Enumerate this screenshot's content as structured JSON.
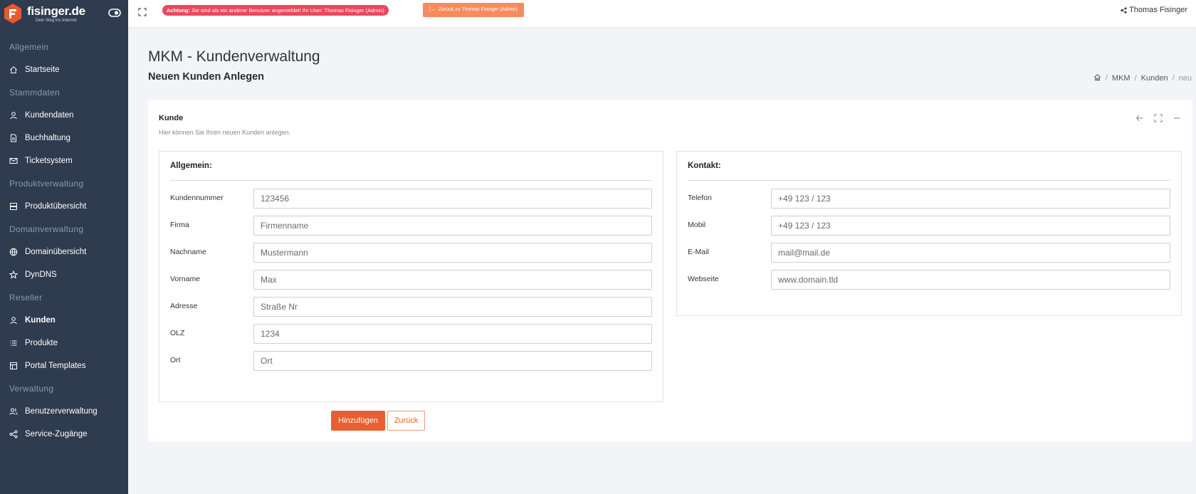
{
  "brand": {
    "title": "fisinger.de",
    "tagline": "Dein Weg ins Internet",
    "color": "#e8592b"
  },
  "sidebar": {
    "sections": [
      {
        "title": "Allgemein",
        "items": [
          {
            "label": "Startseite",
            "icon": "home-icon"
          }
        ]
      },
      {
        "title": "Stammdaten",
        "items": [
          {
            "label": "Kundendaten",
            "icon": "user-icon"
          },
          {
            "label": "Buchhaltung",
            "icon": "document-icon"
          },
          {
            "label": "Ticketsystem",
            "icon": "mail-icon"
          }
        ]
      },
      {
        "title": "Produktverwaltung",
        "items": [
          {
            "label": "Produktübersicht",
            "icon": "server-icon"
          }
        ]
      },
      {
        "title": "Domainverwaltung",
        "items": [
          {
            "label": "Domainübersicht",
            "icon": "globe-icon"
          },
          {
            "label": "DynDNS",
            "icon": "star-icon"
          }
        ]
      },
      {
        "title": "Reseller",
        "items": [
          {
            "label": "Kunden",
            "icon": "user-icon",
            "active": true
          },
          {
            "label": "Produkte",
            "icon": "list-icon"
          },
          {
            "label": "Portal Templates",
            "icon": "layout-icon"
          }
        ]
      },
      {
        "title": "Verwaltung",
        "items": [
          {
            "label": "Benutzerverwaltung",
            "icon": "users-icon"
          },
          {
            "label": "Service-Zugänge",
            "icon": "share-icon"
          }
        ]
      }
    ]
  },
  "topbar": {
    "warning_strong": "Achtung:",
    "warning_text": " Sie sind als ein anderer Benutzer angemeldet! Ihr User: Thomas Fisinger (Admin)",
    "back_button": "Zurück zu Thomas Fisinger (Admin)",
    "user_name": "Thomas Fisinger"
  },
  "page": {
    "title": "MKM - Kundenverwaltung",
    "subtitle": "Neuen Kunden Anlegen",
    "breadcrumb": [
      "MKM",
      "Kunden",
      "neu"
    ]
  },
  "card": {
    "title": "Kunde",
    "description": "Hier können Sie Ihren neuen Kunden anlegen."
  },
  "allgemein": {
    "heading": "Allgemein:",
    "fields": [
      {
        "label": "Kundennummer",
        "placeholder": "123456"
      },
      {
        "label": "Firma",
        "placeholder": "Firmenname"
      },
      {
        "label": "Nachname",
        "placeholder": "Mustermann"
      },
      {
        "label": "Vorname",
        "placeholder": "Max"
      },
      {
        "label": "Adresse",
        "placeholder": "Straße Nr"
      },
      {
        "label": "OLZ",
        "placeholder": "1234"
      },
      {
        "label": "Ort",
        "placeholder": "Ort"
      }
    ]
  },
  "kontakt": {
    "heading": "Kontakt:",
    "fields": [
      {
        "label": "Telefon",
        "placeholder": "+49 123 / 123"
      },
      {
        "label": "Mobil",
        "placeholder": "+49 123 / 123"
      },
      {
        "label": "E-Mail",
        "placeholder": "mail@mail.de"
      },
      {
        "label": "Webseite",
        "placeholder": "www.domain.tld"
      }
    ]
  },
  "actions": {
    "add_label": "Hinzufügen",
    "back_label": "Zurück"
  },
  "colors": {
    "sidebar_bg": "#2f3b4f",
    "accent": "#e85f30",
    "warning": "#e8495e",
    "back_admin": "#f68c5c"
  }
}
